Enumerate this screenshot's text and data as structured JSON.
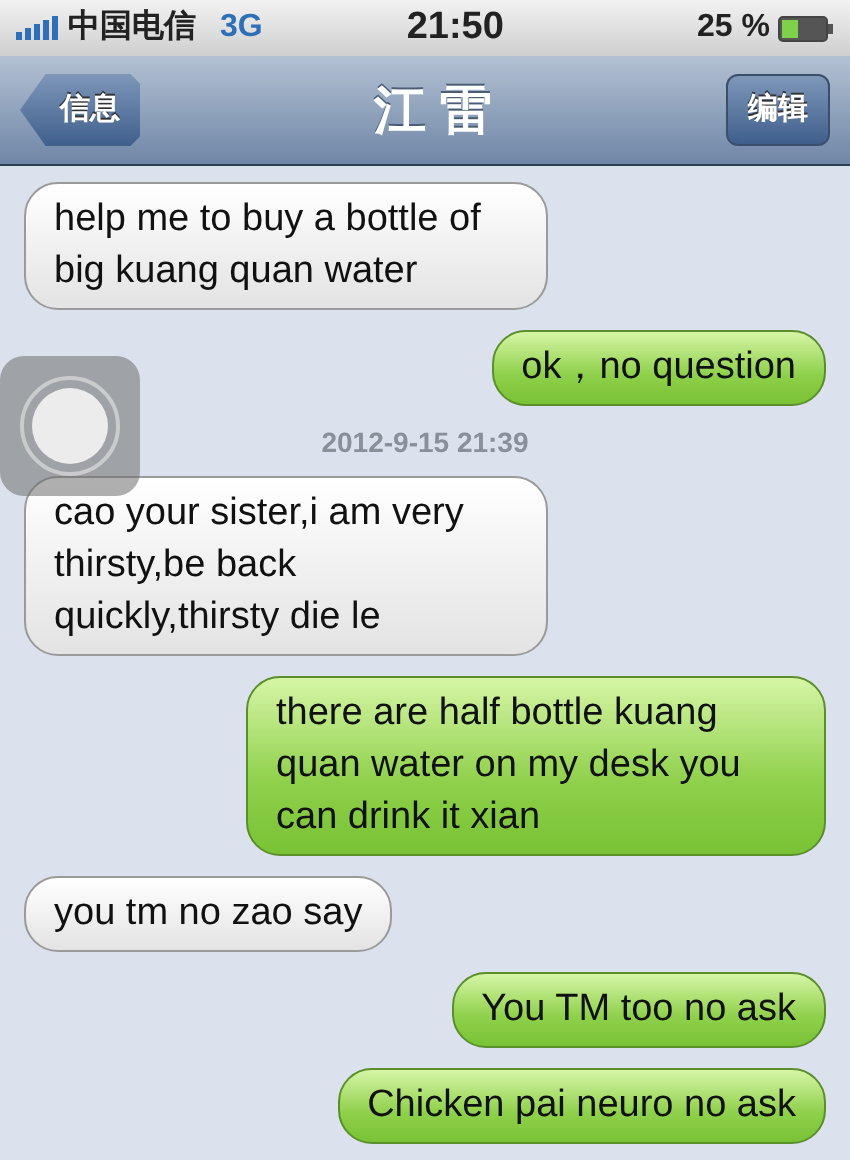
{
  "status_bar": {
    "carrier": "中国电信",
    "network": "3G",
    "time": "21:50",
    "battery": "25 %"
  },
  "nav": {
    "back": "信息",
    "title": "江 雷",
    "edit": "编辑"
  },
  "messages": [
    {
      "kind": "incoming",
      "text": "help me to buy a bottle of big kuang quan water"
    },
    {
      "kind": "outgoing",
      "text": "ok，no question"
    },
    {
      "kind": "timestamp",
      "text": "2012-9-15 21:39"
    },
    {
      "kind": "incoming",
      "text": "cao your sister,i am very thirsty,be back quickly,thirsty die le"
    },
    {
      "kind": "outgoing",
      "text": "there are half bottle kuang quan water on my desk you can drink it xian"
    },
    {
      "kind": "incoming",
      "text": "you tm no zao say"
    },
    {
      "kind": "outgoing",
      "text": "You TM too no ask"
    },
    {
      "kind": "outgoing",
      "text": "Chicken pai neuro no ask"
    }
  ]
}
